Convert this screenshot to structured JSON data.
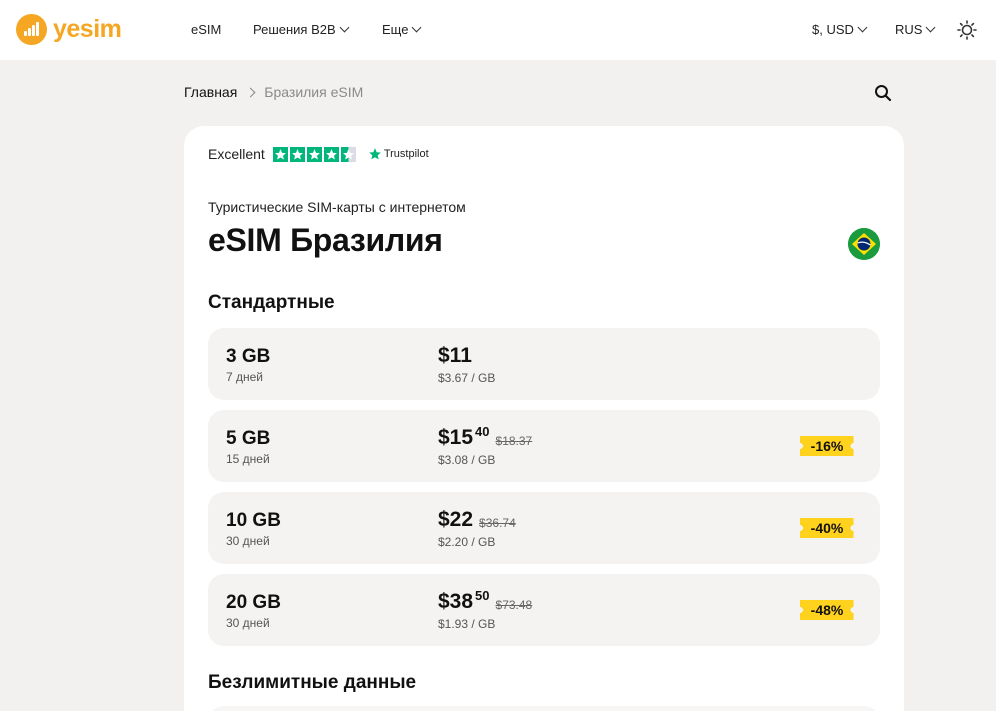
{
  "header": {
    "logo_text": "yesim",
    "nav": [
      {
        "label": "eSIM",
        "dropdown": false
      },
      {
        "label": "Решения B2B",
        "dropdown": true
      },
      {
        "label": "Еще",
        "dropdown": true
      }
    ],
    "currency": "$, USD",
    "language": "RUS",
    "theme_icon": "sun-icon"
  },
  "breadcrumb": {
    "home": "Главная",
    "current": "Бразилия eSIM"
  },
  "trustpilot": {
    "label": "Excellent",
    "rating": 4.5,
    "brand": "Trustpilot",
    "color": "#00b67a"
  },
  "page": {
    "subtitle": "Туристические SIM-карты с интернетом",
    "title": "eSIM Бразилия",
    "flag_icon": "brazil-flag-icon"
  },
  "sections": {
    "standard": "Стандартные",
    "unlimited": "Безлимитные данные"
  },
  "plans": [
    {
      "gb": "3 GB",
      "days": "7 дней",
      "price": "$11",
      "cents": "",
      "old_price": "",
      "per_gb": "$3.67 / GB",
      "discount": ""
    },
    {
      "gb": "5 GB",
      "days": "15 дней",
      "price": "$15",
      "cents": "40",
      "old_price": "$18.37",
      "per_gb": "$3.08 / GB",
      "discount": "-16%"
    },
    {
      "gb": "10 GB",
      "days": "30 дней",
      "price": "$22",
      "cents": "",
      "old_price": "$36.74",
      "per_gb": "$2.20 / GB",
      "discount": "-40%"
    },
    {
      "gb": "20 GB",
      "days": "30 дней",
      "price": "$38",
      "cents": "50",
      "old_price": "$73.48",
      "per_gb": "$1.93 / GB",
      "discount": "-48%"
    }
  ],
  "colors": {
    "brand": "#f5a623",
    "discount_badge": "#ffd21e",
    "plan_bg": "#f4f3f1",
    "page_bg": "#f2f1ef"
  }
}
